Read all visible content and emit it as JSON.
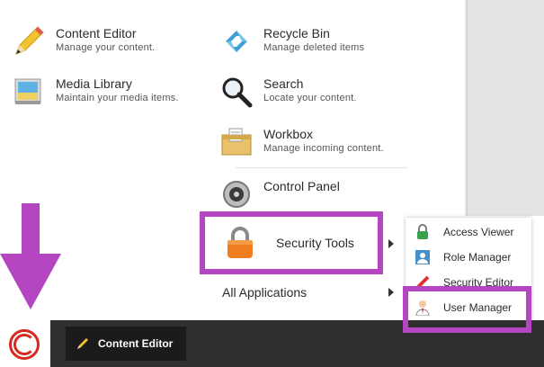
{
  "background": {
    "top_cut_text": "Manage your content."
  },
  "menu": {
    "left_items": [
      {
        "title": "Content Editor",
        "subtitle": "Manage your content.",
        "icon": "pencil-icon"
      },
      {
        "title": "Media Library",
        "subtitle": "Maintain your media items.",
        "icon": "media-library-icon"
      }
    ],
    "right_items": [
      {
        "title": "Recycle Bin",
        "subtitle": "Manage deleted items",
        "icon": "recycle-icon"
      },
      {
        "title": "Search",
        "subtitle": "Locate your content.",
        "icon": "magnifier-icon"
      },
      {
        "title": "Workbox",
        "subtitle": "Manage incoming content.",
        "icon": "workbox-icon"
      },
      {
        "title": "Control Panel",
        "subtitle": "",
        "icon": "control-panel-icon"
      }
    ],
    "security_tools": {
      "title": "Security Tools",
      "icon": "padlock-icon"
    },
    "all_applications": "All Applications"
  },
  "submenu": {
    "items": [
      {
        "label": "Access Viewer",
        "icon": "access-viewer-icon"
      },
      {
        "label": "Role Manager",
        "icon": "role-manager-icon"
      },
      {
        "label": "Security Editor",
        "icon": "security-editor-icon"
      },
      {
        "label": "User Manager",
        "icon": "user-manager-icon"
      }
    ]
  },
  "taskbar": {
    "start_icon": "sitecore-logo-icon",
    "active_app": "Content Editor"
  },
  "colors": {
    "highlight": "#b546c2",
    "taskbar": "#2f2f2f",
    "logo_red": "#d62a1f"
  }
}
